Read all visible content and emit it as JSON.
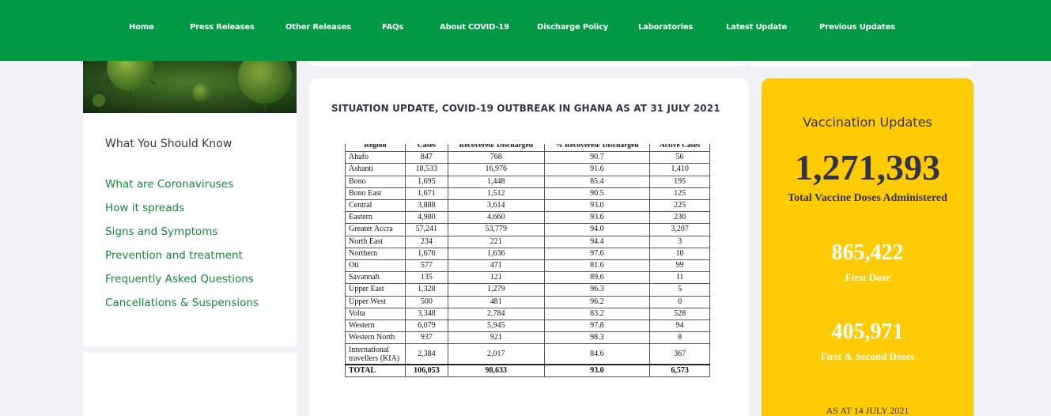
{
  "nav": {
    "items": [
      {
        "label": "Home"
      },
      {
        "label": "Press Releases"
      },
      {
        "label": "Other Releases"
      },
      {
        "label": "FAQs"
      },
      {
        "label": "About COVID-19"
      },
      {
        "label": "Discharge Policy"
      },
      {
        "label": "Laboratories"
      },
      {
        "label": "Latest Update"
      },
      {
        "label": "Previous Updates"
      }
    ]
  },
  "sidebar": {
    "title": "What You Should Know",
    "links": [
      {
        "label": "What are Coronaviruses"
      },
      {
        "label": "How it spreads"
      },
      {
        "label": "Signs and Symptoms"
      },
      {
        "label": "Prevention and treatment"
      },
      {
        "label": "Frequently Asked Questions"
      },
      {
        "label": "Cancellations & Suspensions"
      }
    ]
  },
  "main": {
    "title": "SITUATION UPDATE, COVID-19 OUTBREAK IN GHANA AS AT 31 JULY 2021",
    "table": {
      "headers": [
        "Region",
        "Cases",
        "Recovered/ Discharged",
        "% Recovered/ Discharged",
        "Active Cases"
      ],
      "rows": [
        [
          "Ahafo",
          "847",
          "768",
          "90.7",
          "56"
        ],
        [
          "Ashanti",
          "18,533",
          "16,976",
          "91.6",
          "1,410"
        ],
        [
          "Bono",
          "1,695",
          "1,448",
          "85.4",
          "195"
        ],
        [
          "Bono East",
          "1,671",
          "1,512",
          "90.5",
          "125"
        ],
        [
          "Central",
          "3,888",
          "3,614",
          "93.0",
          "225"
        ],
        [
          "Eastern",
          "4,980",
          "4,660",
          "93.6",
          "230"
        ],
        [
          "Greater Accra",
          "57,241",
          "53,779",
          "94.0",
          "3,207"
        ],
        [
          "North East",
          "234",
          "221",
          "94.4",
          "3"
        ],
        [
          "Northern",
          "1,676",
          "1,636",
          "97.6",
          "10"
        ],
        [
          "Oti",
          "577",
          "471",
          "81.6",
          "99"
        ],
        [
          "Savannah",
          "135",
          "121",
          "89.6",
          "11"
        ],
        [
          "Upper East",
          "1,328",
          "1,279",
          "96.3",
          "5"
        ],
        [
          "Upper West",
          "500",
          "481",
          "96.2",
          "0"
        ],
        [
          "Volta",
          "3,348",
          "2,784",
          "83.2",
          "528"
        ],
        [
          "Western",
          "6,079",
          "5,945",
          "97.8",
          "94"
        ],
        [
          "Western North",
          "937",
          "921",
          "98.3",
          "8"
        ],
        [
          "International travellers (KIA)",
          "2,384",
          "2,017",
          "84.6",
          "367"
        ]
      ],
      "total": [
        "TOTAL",
        "106,053",
        "98,633",
        "93.0",
        "6,573"
      ]
    }
  },
  "vaccination": {
    "title": "Vaccination Updates",
    "total_doses": "1,271,393",
    "total_label": "Total Vaccine Doses Administered",
    "first_dose": "865,422",
    "first_dose_label": "First Dose",
    "both_doses": "405,971",
    "both_doses_label": "First & Second Doses",
    "as_at": "AS AT 14 JULY 2021"
  },
  "colors": {
    "nav_bg": "#009a44",
    "link_green": "#0e8a3c",
    "vax_yellow": "#ffcb05",
    "text_dark": "#33334a"
  }
}
